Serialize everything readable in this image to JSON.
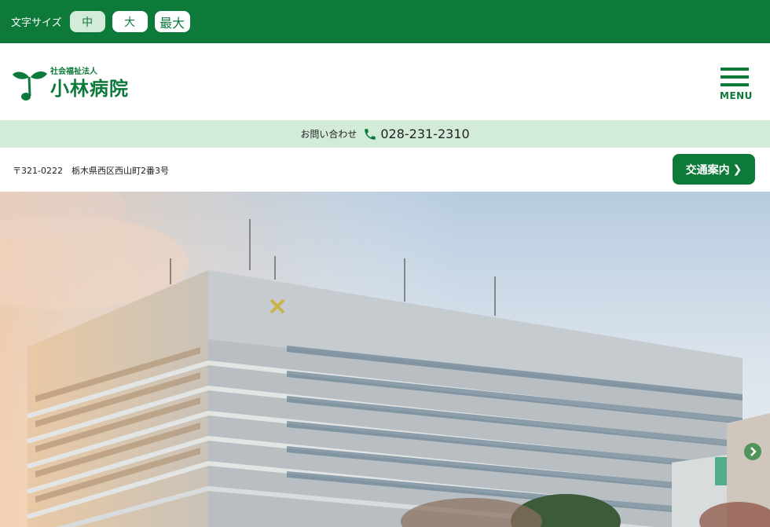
{
  "font_size_bar": {
    "label": "文字サイズ",
    "options": [
      "中",
      "大",
      "最大"
    ]
  },
  "header": {
    "org_type": "社会福祉法人",
    "hospital_name": "小林病院",
    "menu_label": "MENU"
  },
  "contact": {
    "label": "お問い合わせ",
    "phone": "028-231-2310"
  },
  "address": {
    "text": "〒321-0222　栃木県西区西山町2番3号",
    "access_button": "交通案内"
  },
  "colors": {
    "brand_green": "#0d7a3a",
    "light_green": "#d3ecd9"
  },
  "icons": {
    "logo": "sprout-icon",
    "phone": "phone-icon",
    "menu": "hamburger-icon",
    "next": "chevron-right-circle-icon"
  }
}
